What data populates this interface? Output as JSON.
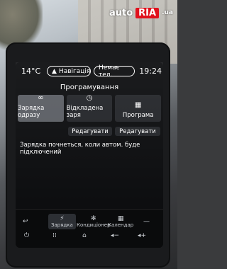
{
  "watermark": {
    "part1": "auto",
    "part2": "RIA",
    "suffix": ".ua"
  },
  "status": {
    "temperature": "14°C",
    "navigation_label": "Навігація",
    "phone_label": "Немає тел.",
    "time": "19:24"
  },
  "screen_title": "Програмування",
  "tiles": [
    {
      "label": "Зарядка одразу",
      "icon": "infinity-icon",
      "active": true
    },
    {
      "label": "Відкладена заря",
      "icon": "clock-icon",
      "active": false
    },
    {
      "label": "Програма",
      "icon": "calendar-icon",
      "active": false
    }
  ],
  "edit_buttons": [
    "Редагувати",
    "Редагувати"
  ],
  "message": "Зарядка почнеться, коли автом. буде підключений",
  "bottom_bar": {
    "items": [
      {
        "label": "",
        "icon": "back-arrow-icon"
      },
      {
        "label": "Зарядка",
        "icon": "charging-icon",
        "selected": true
      },
      {
        "label": "Кондиціонер",
        "icon": "fan-icon"
      },
      {
        "label": "Календар",
        "icon": "calendar-icon"
      },
      {
        "label": "",
        "icon": "dash-icon"
      }
    ],
    "system": [
      "power-icon",
      "apps-icon",
      "home-icon",
      "volume-down-icon",
      "volume-up-icon"
    ]
  },
  "colors": {
    "screen": "#0d0e10",
    "active_tile": "#5b5e64",
    "tile": "#24262a",
    "ria_red": "#e0111c"
  }
}
